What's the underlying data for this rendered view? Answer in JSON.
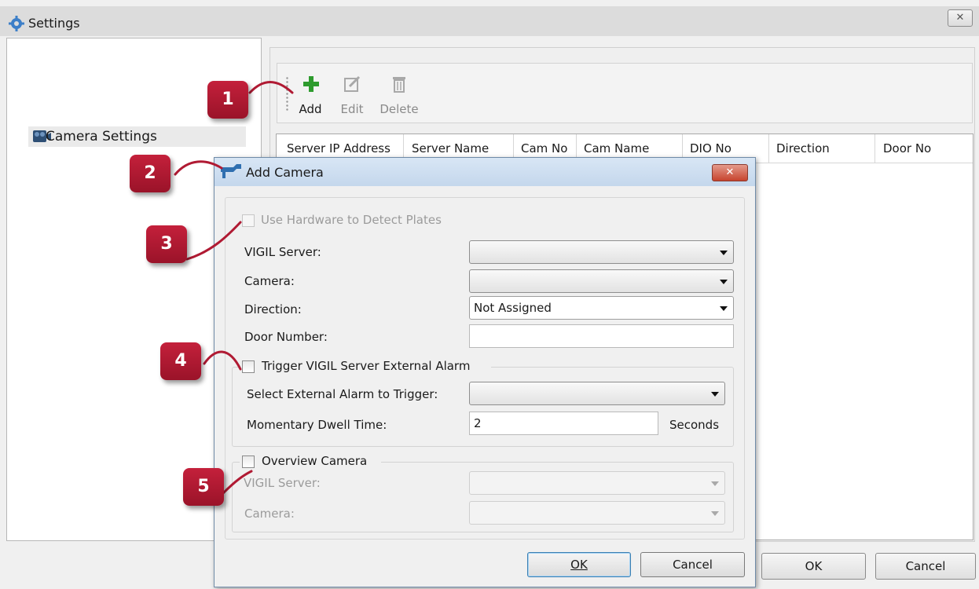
{
  "window": {
    "title": "Settings",
    "close_glyph": "✕"
  },
  "tree": {
    "item_label": "Camera Settings"
  },
  "toolbar": {
    "add_label": "Add",
    "edit_label": "Edit",
    "delete_label": "Delete"
  },
  "grid": {
    "columns": [
      "Server IP Address",
      "Server Name",
      "Cam No",
      "Cam Name",
      "DIO No",
      "Direction",
      "Door No"
    ]
  },
  "main_buttons": {
    "ok": "OK",
    "cancel": "Cancel"
  },
  "dialog": {
    "title": "Add Camera",
    "close_glyph": "✕",
    "hardware_checkbox_label": "Use Hardware to Detect Plates",
    "vigil_server_label": "VIGIL Server:",
    "vigil_server_value": "",
    "camera_label": "Camera:",
    "camera_value": "",
    "direction_label": "Direction:",
    "direction_value": "Not Assigned",
    "door_number_label": "Door Number:",
    "door_number_value": "",
    "alarm_group": {
      "checkbox_label": "Trigger VIGIL Server External Alarm",
      "select_label": "Select External Alarm to Trigger:",
      "select_value": "",
      "dwell_label": "Momentary Dwell Time:",
      "dwell_value": "2",
      "dwell_unit": "Seconds"
    },
    "overview_group": {
      "checkbox_label": "Overview Camera",
      "server_label": "VIGIL Server:",
      "camera_label": "Camera:"
    },
    "ok_label": "OK",
    "cancel_label": "Cancel"
  },
  "callouts": [
    "1",
    "2",
    "3",
    "4",
    "5"
  ],
  "colors": {
    "callout": "#b01a33",
    "add_icon": "#2e9b2e",
    "dialog_title": "#c9dbef"
  }
}
